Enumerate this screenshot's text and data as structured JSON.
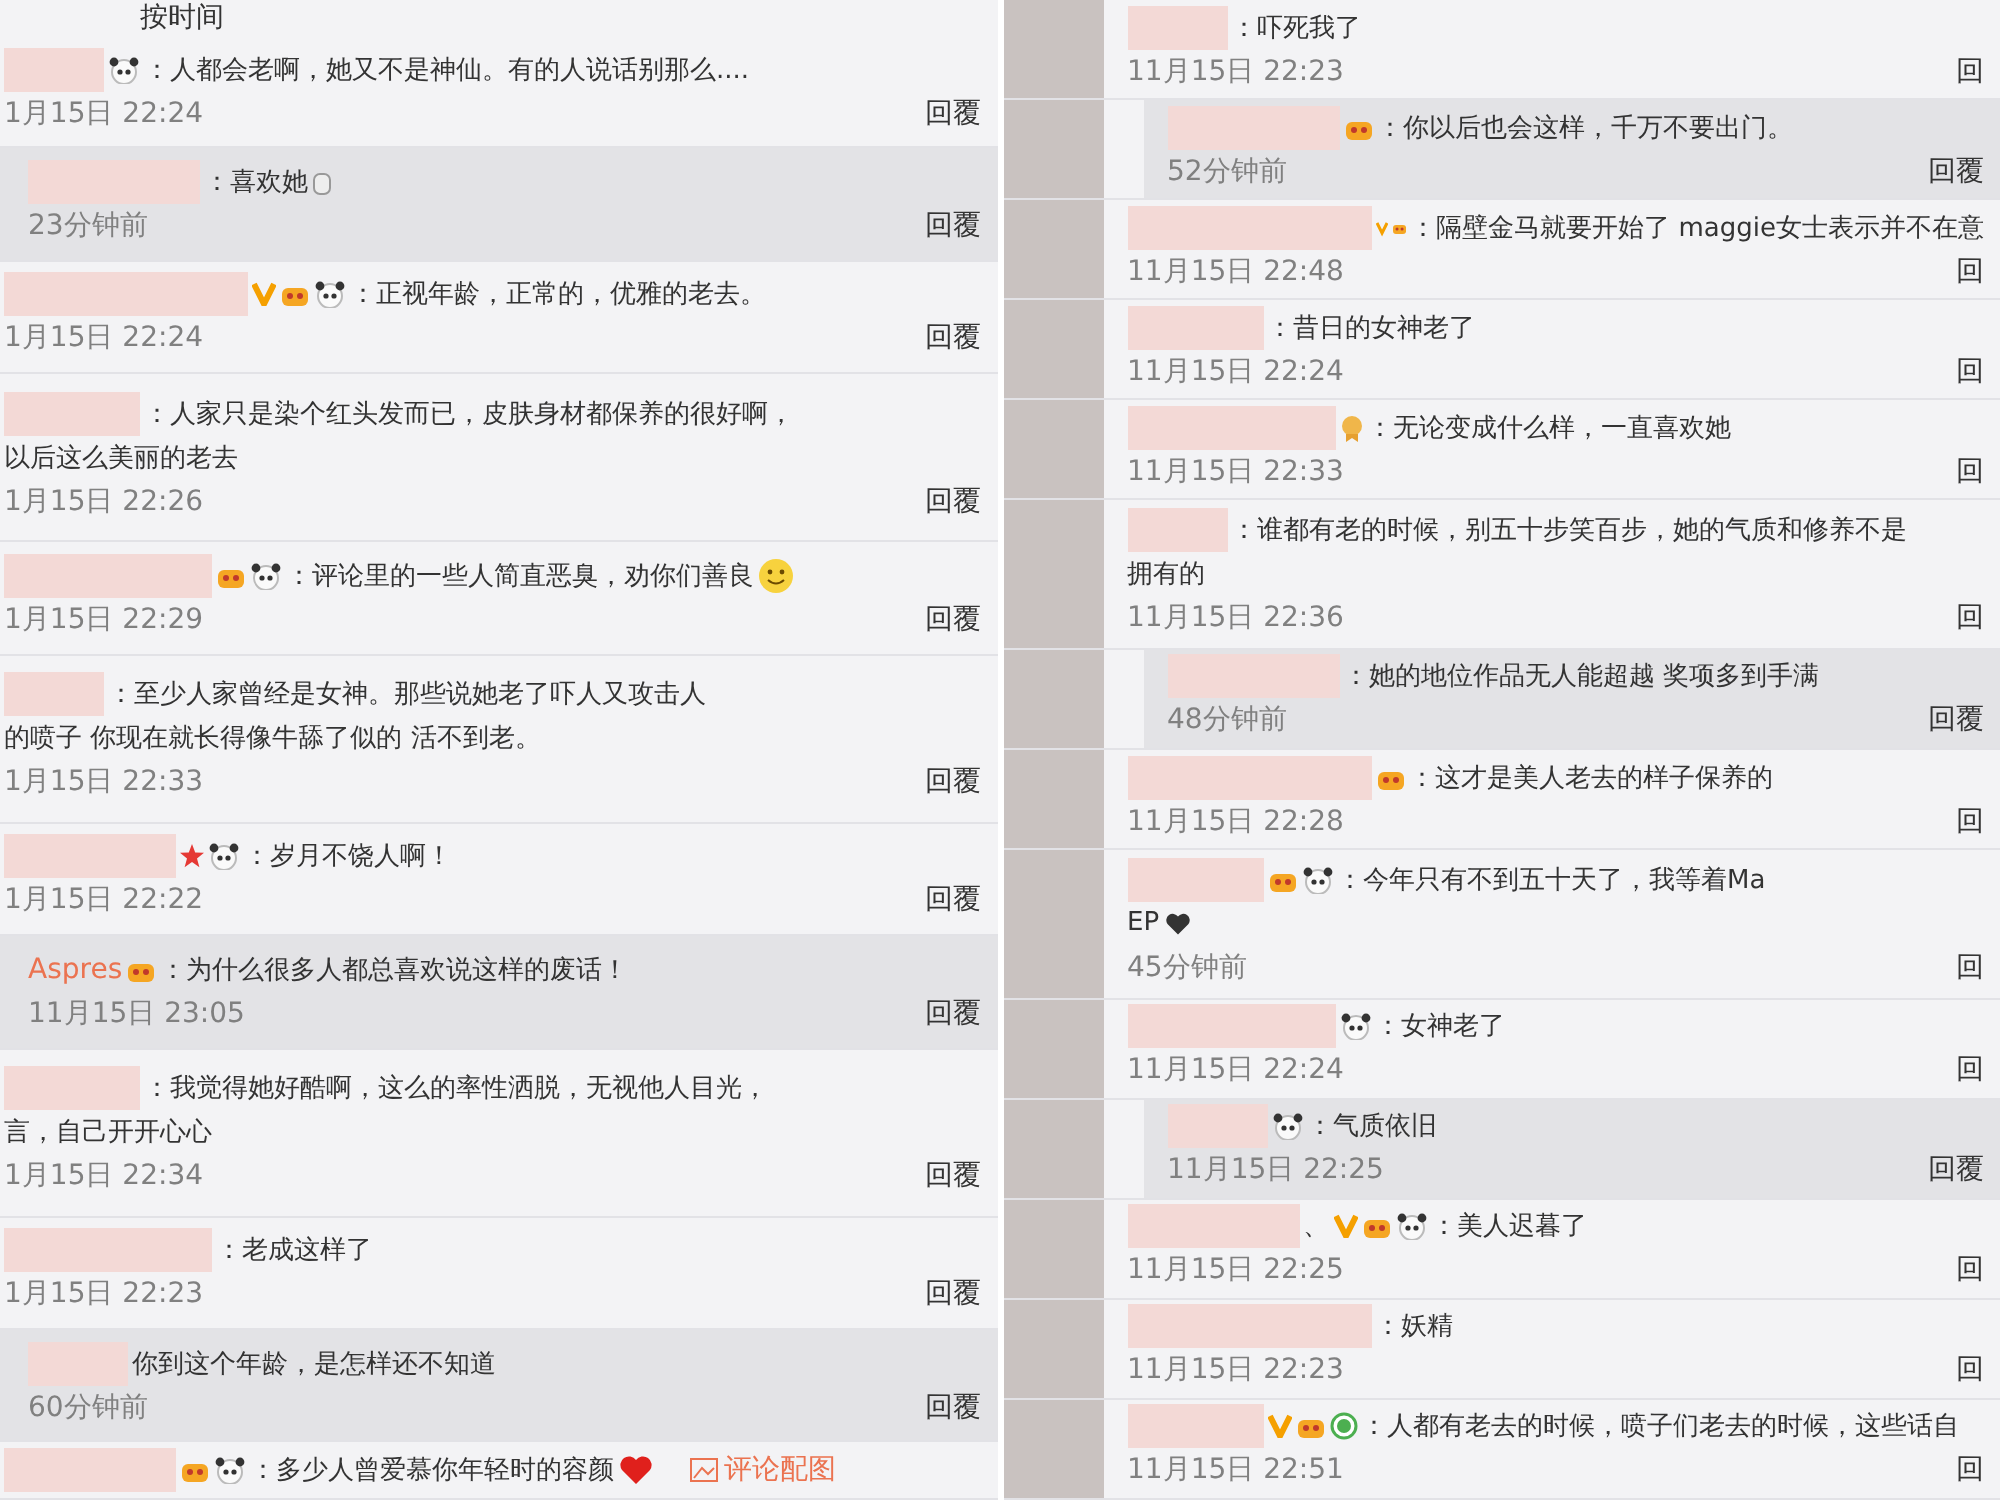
{
  "left_column": {
    "sort_label": "按时间",
    "comments": [
      {
        "reply": false,
        "icons": [
          {
            "kind": "panda"
          }
        ],
        "lines": [
          "：人都会老啊，她又不是神仙。有的人说话别那么...."
        ],
        "time": "1月15日 22:24",
        "reply_label": "回覆"
      },
      {
        "reply": true,
        "lines": [
          "：喜欢她"
        ],
        "emoji": {
          "kind": "hand"
        },
        "time": "23分钟前",
        "reply_label": "回覆"
      },
      {
        "reply": false,
        "icons": [
          {
            "kind": "v"
          },
          {
            "kind": "crown"
          },
          {
            "kind": "panda"
          }
        ],
        "lines": [
          "：正视年龄，正常的，优雅的老去。"
        ],
        "time": "1月15日 22:24",
        "reply_label": "回覆"
      },
      {
        "reply": false,
        "lines": [
          "：人家只是染个红头发而已，皮肤身材都保养的很好啊，",
          "以后这么美丽的老去"
        ],
        "time": "1月15日 22:26",
        "reply_label": "回覆"
      },
      {
        "reply": false,
        "icons": [
          {
            "kind": "crown"
          },
          {
            "kind": "panda"
          }
        ],
        "lines": [
          "：评论里的一些人简直恶臭，劝你们善良"
        ],
        "emoji": {
          "kind": "smiley"
        },
        "time": "1月15日 22:29",
        "reply_label": "回覆"
      },
      {
        "reply": false,
        "lines": [
          "：至少人家曾经是女神。那些说她老了吓人又攻击人",
          "的喷子  你现在就长得像牛舔了似的 活不到老。"
        ],
        "time": "1月15日 22:33",
        "reply_label": "回覆"
      },
      {
        "reply": false,
        "icons": [
          {
            "kind": "star"
          },
          {
            "kind": "panda"
          }
        ],
        "lines": [
          "：岁月不饶人啊！"
        ],
        "time": "1月15日 22:22",
        "reply_label": "回覆"
      },
      {
        "reply": true,
        "name": "Aspres",
        "icons": [
          {
            "kind": "crown"
          }
        ],
        "lines": [
          "：为什么很多人都总喜欢说这样的废话！"
        ],
        "time": "11月15日 23:05",
        "reply_label": "回覆"
      },
      {
        "reply": false,
        "lines": [
          "：我觉得她好酷啊，这么的率性洒脱，无视他人目光，",
          "言，自己开开心心"
        ],
        "time": "1月15日 22:34",
        "reply_label": "回覆"
      },
      {
        "reply": false,
        "lines": [
          "：老成这样了"
        ],
        "time": "1月15日 22:23",
        "reply_label": "回覆"
      },
      {
        "reply": true,
        "lines": [
          "你到这个年龄，是怎样还不知道"
        ],
        "time": "60分钟前",
        "reply_label": "回覆"
      },
      {
        "reply": false,
        "icons": [
          {
            "kind": "crown"
          },
          {
            "kind": "panda"
          }
        ],
        "lines": [
          "：多少人曾爱慕你年轻时的容颜"
        ],
        "emoji": {
          "kind": "heart"
        },
        "link": "评论配图"
      }
    ]
  },
  "right_column": {
    "comments": [
      {
        "reply": false,
        "lines": [
          "：吓死我了"
        ],
        "time": "11月15日 22:23",
        "reply_label": "回"
      },
      {
        "reply": true,
        "icons": [
          {
            "kind": "crown"
          }
        ],
        "lines": [
          "：你以后也会这样，千万不要出门。"
        ],
        "time": "52分钟前",
        "reply_label": "回覆"
      },
      {
        "reply": false,
        "icons": [
          {
            "kind": "v"
          },
          {
            "kind": "crown"
          }
        ],
        "lines": [
          "：隔壁金马就要开始了 maggie女士表示并不在意"
        ],
        "time": "11月15日 22:48",
        "reply_label": "回"
      },
      {
        "reply": false,
        "lines": [
          "：昔日的女神老了"
        ],
        "time": "11月15日 22:24",
        "reply_label": "回"
      },
      {
        "reply": false,
        "icons": [
          {
            "kind": "medal"
          }
        ],
        "lines": [
          "：无论变成什么样，一直喜欢她"
        ],
        "time": "11月15日 22:33",
        "reply_label": "回"
      },
      {
        "reply": false,
        "lines": [
          "：谁都有老的时候，别五十步笑百步，她的气质和修养不是",
          "拥有的"
        ],
        "time": "11月15日 22:36",
        "reply_label": "回"
      },
      {
        "reply": true,
        "lines": [
          "：她的地位作品无人能超越 奖项多到手满"
        ],
        "time": "48分钟前",
        "reply_label": "回覆"
      },
      {
        "reply": false,
        "icons": [
          {
            "kind": "crown"
          }
        ],
        "lines": [
          "：这才是美人老去的样子保养的"
        ],
        "time": "11月15日 22:28",
        "reply_label": "回"
      },
      {
        "reply": false,
        "icons": [
          {
            "kind": "crown"
          },
          {
            "kind": "panda"
          }
        ],
        "lines": [
          "：今年只有不到五十天了，我等着Ma",
          "EP"
        ],
        "emoji": {
          "kind": "dark-heart"
        },
        "time": "45分钟前",
        "reply_label": "回"
      },
      {
        "reply": false,
        "icons": [
          {
            "kind": "panda"
          }
        ],
        "lines": [
          "：女神老了"
        ],
        "time": "11月15日 22:24",
        "reply_label": "回"
      },
      {
        "reply": true,
        "icons": [
          {
            "kind": "panda"
          }
        ],
        "lines": [
          "：气质依旧"
        ],
        "time": "11月15日 22:25",
        "reply_label": "回覆"
      },
      {
        "reply": false,
        "name_tail": "、",
        "icons": [
          {
            "kind": "v"
          },
          {
            "kind": "crown"
          },
          {
            "kind": "panda"
          }
        ],
        "lines": [
          "：美人迟暮了"
        ],
        "time": "11月15日 22:25",
        "reply_label": "回"
      },
      {
        "reply": false,
        "lines": [
          "：妖精"
        ],
        "time": "11月15日 22:23",
        "reply_label": "回"
      },
      {
        "reply": false,
        "icons": [
          {
            "kind": "v"
          },
          {
            "kind": "crown"
          },
          {
            "kind": "green"
          }
        ],
        "lines": [
          "：人都有老去的时候，喷子们老去的时候，这些话自"
        ],
        "time": "11月15日 22:51",
        "reply_label": "回"
      }
    ]
  }
}
